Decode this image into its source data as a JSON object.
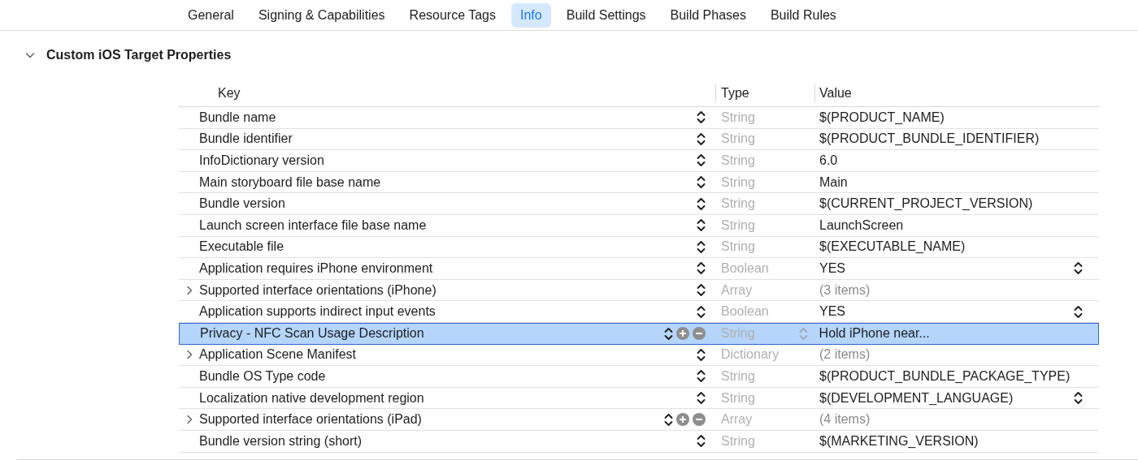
{
  "tabs": [
    {
      "label": "General",
      "selected": false
    },
    {
      "label": "Signing & Capabilities",
      "selected": false
    },
    {
      "label": "Resource Tags",
      "selected": false
    },
    {
      "label": "Info",
      "selected": true
    },
    {
      "label": "Build Settings",
      "selected": false
    },
    {
      "label": "Build Phases",
      "selected": false
    },
    {
      "label": "Build Rules",
      "selected": false
    }
  ],
  "section": {
    "title": "Custom iOS Target Properties",
    "expanded": true
  },
  "table": {
    "columns": [
      "Key",
      "Type",
      "Value"
    ],
    "rows": [
      {
        "key": "Bundle name",
        "type": "String",
        "value": "$(PRODUCT_NAME)",
        "selected": false,
        "add_remove": false,
        "type_popup": false,
        "value_popup": false
      },
      {
        "key": "Bundle identifier",
        "type": "String",
        "value": "$(PRODUCT_BUNDLE_IDENTIFIER)",
        "selected": false,
        "add_remove": false,
        "type_popup": false,
        "value_popup": false
      },
      {
        "key": "InfoDictionary version",
        "type": "String",
        "value": "6.0",
        "selected": false,
        "add_remove": false,
        "type_popup": false,
        "value_popup": false
      },
      {
        "key": "Main storyboard file base name",
        "type": "String",
        "value": "Main",
        "selected": false,
        "add_remove": false,
        "type_popup": false,
        "value_popup": false
      },
      {
        "key": "Bundle version",
        "type": "String",
        "value": "$(CURRENT_PROJECT_VERSION)",
        "selected": false,
        "add_remove": false,
        "type_popup": false,
        "value_popup": false
      },
      {
        "key": "Launch screen interface file base name",
        "type": "String",
        "value": "LaunchScreen",
        "selected": false,
        "add_remove": false,
        "type_popup": false,
        "value_popup": false
      },
      {
        "key": "Executable file",
        "type": "String",
        "value": "$(EXECUTABLE_NAME)",
        "selected": false,
        "add_remove": false,
        "type_popup": false,
        "value_popup": false
      },
      {
        "key": "Application requires iPhone environment",
        "type": "Boolean",
        "value": "YES",
        "selected": false,
        "add_remove": false,
        "type_popup": false,
        "value_popup": true
      },
      {
        "key": "Supported interface orientations (iPhone)",
        "type": "Array",
        "value": "(3 items)",
        "kind": "collection",
        "expanded": false,
        "selected": false,
        "add_remove": false,
        "type_popup": false,
        "value_popup": false
      },
      {
        "key": "Application supports indirect input events",
        "type": "Boolean",
        "value": "YES",
        "selected": false,
        "add_remove": false,
        "type_popup": false,
        "value_popup": true
      },
      {
        "key": "Privacy - NFC Scan Usage Description",
        "type": "String",
        "value": "Hold iPhone near...",
        "selected": true,
        "add_remove": true,
        "type_popup": true,
        "value_popup": false
      },
      {
        "key": "Application Scene Manifest",
        "type": "Dictionary",
        "value": "(2 items)",
        "kind": "collection",
        "expanded": false,
        "selected": false,
        "add_remove": false,
        "type_popup": false,
        "value_popup": false
      },
      {
        "key": "Bundle OS Type code",
        "type": "String",
        "value": "$(PRODUCT_BUNDLE_PACKAGE_TYPE)",
        "selected": false,
        "add_remove": false,
        "type_popup": false,
        "value_popup": false
      },
      {
        "key": "Localization native development region",
        "type": "String",
        "value": "$(DEVELOPMENT_LANGUAGE)",
        "selected": false,
        "add_remove": false,
        "type_popup": false,
        "value_popup": true
      },
      {
        "key": "Supported interface orientations (iPad)",
        "type": "Array",
        "value": "(4 items)",
        "kind": "collection",
        "expanded": false,
        "selected": false,
        "add_remove": true,
        "type_popup": false,
        "value_popup": false
      },
      {
        "key": "Bundle version string (short)",
        "type": "String",
        "value": "$(MARKETING_VERSION)",
        "selected": false,
        "add_remove": false,
        "type_popup": false,
        "value_popup": false
      }
    ]
  }
}
